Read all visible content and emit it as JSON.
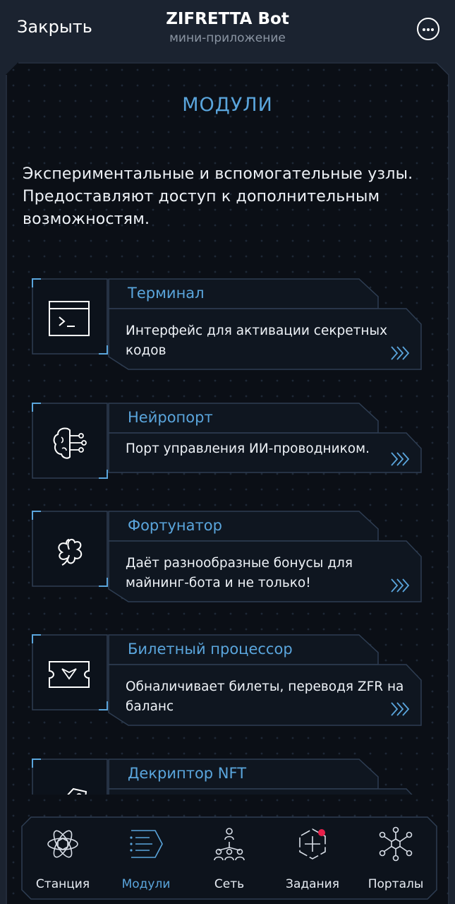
{
  "header": {
    "close_label": "Закрыть",
    "title": "ZIFRETTA Bot",
    "subtitle": "мини-приложение",
    "more_icon": "more-dots-icon"
  },
  "page": {
    "title": "МОДУЛИ",
    "intro": "Экспериментальные и вспомогательные узлы. Предоставляют доступ к дополнительным возможностям."
  },
  "modules": [
    {
      "title": "Терминал",
      "description": "Интерфейс для активации секретных кодов",
      "icon": "terminal-icon"
    },
    {
      "title": "Нейропорт",
      "description": "Порт управления ИИ-проводником.",
      "icon": "brain-circuit-icon"
    },
    {
      "title": "Фортунатор",
      "description": "Даёт разнообразные бонусы для майнинг-бота и не только!",
      "icon": "clover-icon"
    },
    {
      "title": "Билетный процессор",
      "description": "Обналичивает билеты, переводя ZFR на баланс",
      "icon": "ticket-icon"
    },
    {
      "title": "Декриптор NFT",
      "description": "",
      "icon": "nft-tag-icon"
    }
  ],
  "nav": {
    "items": [
      {
        "label": "Станция",
        "icon": "atom-station-icon",
        "active": false
      },
      {
        "label": "Модули",
        "icon": "modules-list-icon",
        "active": true
      },
      {
        "label": "Сеть",
        "icon": "network-tree-icon",
        "active": false
      },
      {
        "label": "Задания",
        "icon": "tasks-hexagon-icon",
        "active": false,
        "badge": true
      },
      {
        "label": "Порталы",
        "icon": "portals-hub-icon",
        "active": false
      }
    ]
  },
  "colors": {
    "accent": "#5aa5dc",
    "background": "#0b0f16",
    "card_border": "#2e3d52",
    "badge": "#e8204a"
  }
}
